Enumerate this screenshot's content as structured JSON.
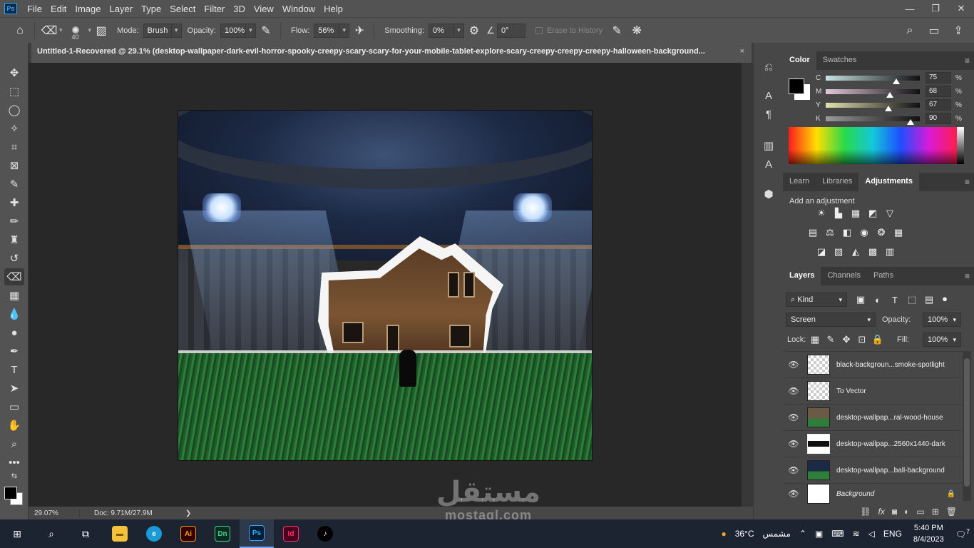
{
  "menu": {
    "logo": "Ps",
    "items": [
      "File",
      "Edit",
      "Image",
      "Layer",
      "Type",
      "Select",
      "Filter",
      "3D",
      "View",
      "Window",
      "Help"
    ]
  },
  "options_bar": {
    "brush_size": "40",
    "mode_label": "Mode:",
    "mode_value": "Brush",
    "opacity_label": "Opacity:",
    "opacity_value": "100%",
    "flow_label": "Flow:",
    "flow_value": "56%",
    "smoothing_label": "Smoothing:",
    "smoothing_value": "0%",
    "angle_value": "0°",
    "erase_history_label": "Erase to History"
  },
  "document": {
    "tab_title": "Untitled-1-Recovered @ 29.1% (desktop-wallpaper-dark-evil-horror-spooky-creepy-scary-scary-for-your-mobile-tablet-explore-scary-creepy-creepy-creepy-halloween-background...",
    "tab_close": "×",
    "zoom": "29.07%",
    "doc_size": "Doc: 9.71M/27.9M",
    "status_arrow": "❯"
  },
  "color_panel": {
    "tabs": [
      "Color",
      "Swatches"
    ],
    "active_tab": "Color",
    "channels": [
      {
        "letter": "C",
        "value": "75",
        "fill": 0.75,
        "color": "#c7e3e3"
      },
      {
        "letter": "M",
        "value": "68",
        "fill": 0.68,
        "color": "#e3c7d9"
      },
      {
        "letter": "Y",
        "value": "67",
        "fill": 0.67,
        "color": "#e3e0b0"
      },
      {
        "letter": "K",
        "value": "90",
        "fill": 0.9,
        "color": "#9a9a9a"
      }
    ],
    "pct": "%"
  },
  "adjustments_panel": {
    "tabs": [
      "Learn",
      "Libraries",
      "Adjustments"
    ],
    "active_tab": "Adjustments",
    "title": "Add an adjustment"
  },
  "layers_panel": {
    "tabs": [
      "Layers",
      "Channels",
      "Paths"
    ],
    "active_tab": "Layers",
    "filter_kind": "Kind",
    "blend_mode": "Screen",
    "opacity_label": "Opacity:",
    "opacity_value": "100%",
    "lock_label": "Lock:",
    "fill_label": "Fill:",
    "fill_value": "100%",
    "layers": [
      {
        "name": "black-backgroun...smoke-spotlight",
        "selected": false,
        "italic": false
      },
      {
        "name": "To Vector",
        "selected": false,
        "italic": false
      },
      {
        "name": "desktop-wallpap...ral-wood-house",
        "selected": false,
        "italic": false
      },
      {
        "name": "desktop-wallpap...2560x1440-dark",
        "selected": true,
        "italic": false
      },
      {
        "name": "desktop-wallpap...ball-background",
        "selected": false,
        "italic": false
      },
      {
        "name": "Background",
        "selected": false,
        "italic": true
      }
    ]
  },
  "taskbar": {
    "apps": [
      "Ai",
      "Dn",
      "Ps",
      "Id"
    ],
    "weather_temp": "36°C",
    "weather_text": "مشمس",
    "language": "ENG",
    "time": "5:40 PM",
    "date": "8/4/2023",
    "notifications": "7"
  },
  "watermark": {
    "arabic": "مستقل",
    "latin": "mostaql.com"
  }
}
